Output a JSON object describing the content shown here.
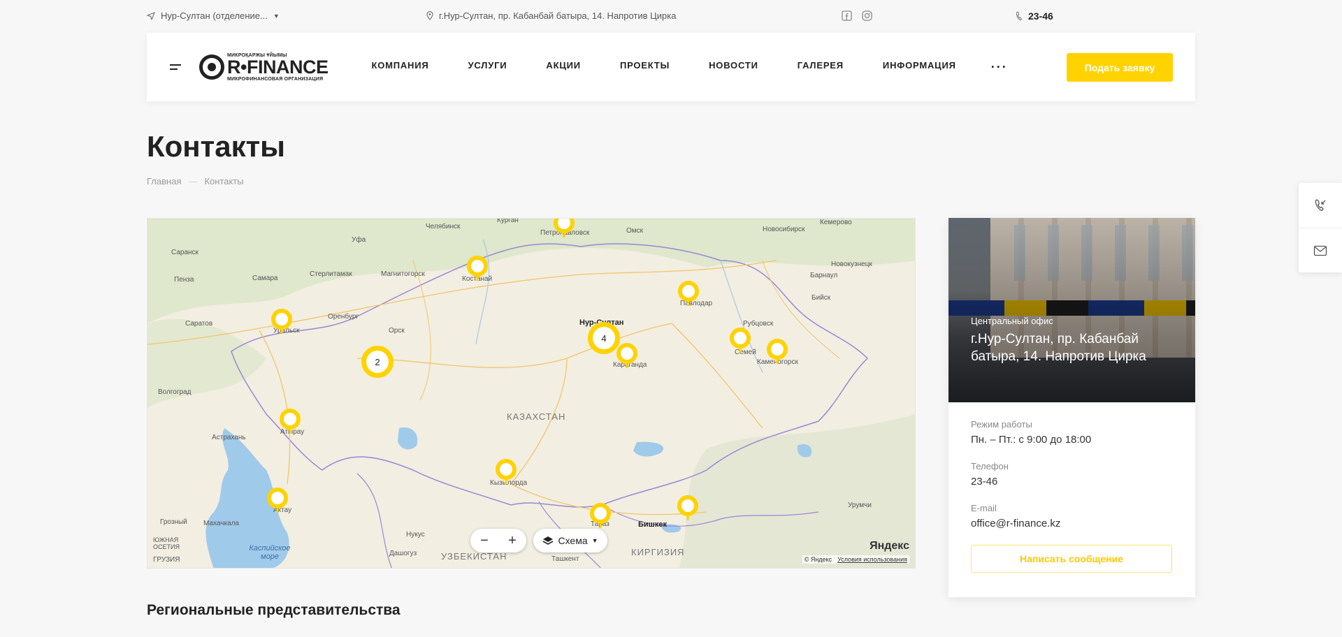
{
  "topbar": {
    "city": "Нур-Султан (отделение...",
    "address": "г.Нур-Султан, пр. Кабанбай батыра, 14. Напротив Цирка",
    "phone": "23-46"
  },
  "header": {
    "logo_small_top": "МИКРОҚАРЖЫ ҰЙЫМЫ",
    "logo_name": "R•FINANCE",
    "logo_small_bottom": "МИКРОФИНАНСОВАЯ ОРГАНИЗАЦИЯ",
    "nav": [
      "КОМПАНИЯ",
      "УСЛУГИ",
      "АКЦИИ",
      "ПРОЕКТЫ",
      "НОВОСТИ",
      "ГАЛЕРЕЯ",
      "ИНФОРМАЦИЯ"
    ],
    "more": "···",
    "cta": "Подать заявку"
  },
  "page": {
    "title": "Контакты",
    "breadcrumb": [
      "Главная",
      "—",
      "Контакты"
    ],
    "section_title": "Региональные представительства"
  },
  "map": {
    "country": "КАЗАХСТАН",
    "labels": [
      "Челябинск",
      "Курган",
      "Петропавловск",
      "Омск",
      "Новосибирск",
      "Кемерово",
      "Уфа",
      "Саранск",
      "Пенза",
      "Самара",
      "Стерлитамак",
      "Магнитогорск",
      "Костанай",
      "Барнаул",
      "Новокузнецк",
      "Саратов",
      "Оренбург",
      "Уральск",
      "Орск",
      "Нур-Султан",
      "Павлодар",
      "Бийск",
      "Рубцовск",
      "Семей",
      "Караганда",
      "Каменогорск",
      "Волгоград",
      "Астрахань",
      "Атырау",
      "Кызылорда",
      "Актау",
      "Грозный",
      "Махачкала",
      "ЮЖНАЯ ОСЕТИЯ",
      "ГРУЗИЯ",
      "Нукус",
      "Дашогуз",
      "УЗБЕКИСТАН",
      "Тараз",
      "Бишкек",
      "КИРГИЗИЯ",
      "Урумчи",
      "Ташкент",
      "Каспийское море"
    ],
    "clusters": [
      "2",
      "4"
    ],
    "scheme": "Схема",
    "zoom_minus": "−",
    "zoom_plus": "+",
    "brand": "Яндекс",
    "copyright": "© Яндекс",
    "terms": "Условия использования"
  },
  "office": {
    "label": "Центральный офис",
    "address": "г.Нур-Султан, пр. Кабанбай батыра, 14. Напротив Цирка",
    "hours_label": "Режим работы",
    "hours": "Пн. – Пт.: с 9:00 до 18:00",
    "phone_label": "Телефон",
    "phone": "23-46",
    "email_label": "E-mail",
    "email": "office@r-finance.kz",
    "button": "Написать сообщение"
  },
  "colors": {
    "accent": "#ffd200",
    "text": "#222222"
  },
  "icons": [
    "navigation-icon",
    "location-pin-icon",
    "facebook-icon",
    "instagram-icon",
    "phone-icon",
    "callback-icon",
    "mail-icon",
    "layers-icon"
  ]
}
